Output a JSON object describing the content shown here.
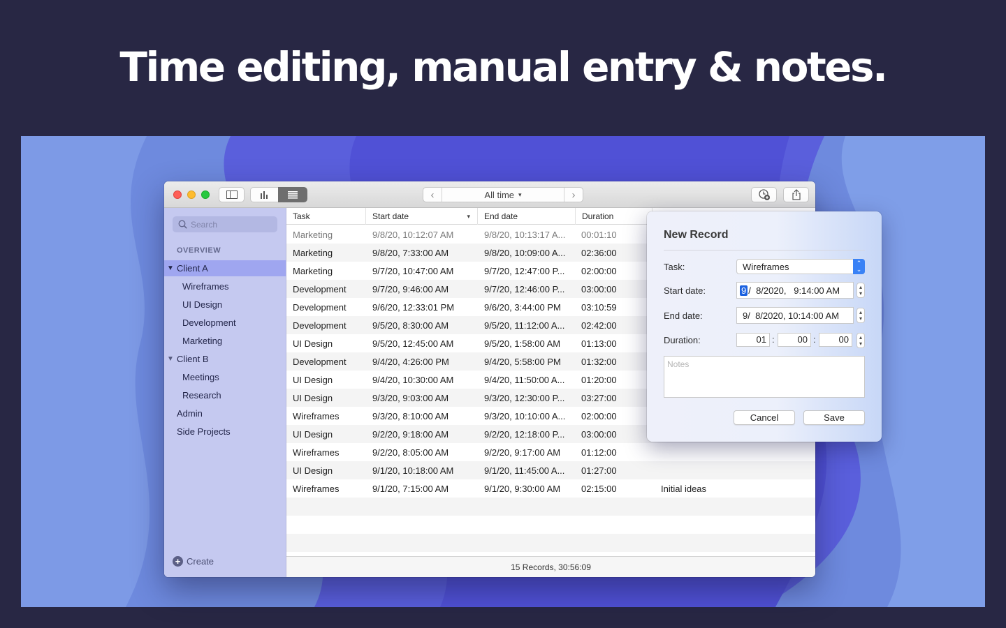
{
  "headline": "Time editing, manual entry & notes.",
  "toolbar": {
    "range_label": "All time",
    "prev_icon": "chevron-left-icon",
    "next_icon": "chevron-right-icon"
  },
  "sidebar": {
    "search_placeholder": "Search",
    "section": "OVERVIEW",
    "clients": [
      {
        "label": "Client A",
        "selected": true,
        "tasks": [
          "Wireframes",
          "UI Design",
          "Development",
          "Marketing"
        ]
      },
      {
        "label": "Client B",
        "selected": false,
        "tasks": [
          "Meetings",
          "Research"
        ]
      }
    ],
    "others": [
      "Admin",
      "Side Projects"
    ],
    "create_label": "Create"
  },
  "table": {
    "columns": [
      "Task",
      "Start date",
      "End date",
      "Duration"
    ],
    "rows": [
      {
        "task": "Marketing",
        "start": "9/8/20, 10:12:07 AM",
        "end": "9/8/20, 10:13:17 A...",
        "duration": "00:01:10",
        "note": "",
        "dim": true
      },
      {
        "task": "Marketing",
        "start": "9/8/20, 7:33:00 AM",
        "end": "9/8/20, 10:09:00 A...",
        "duration": "02:36:00",
        "note": ""
      },
      {
        "task": "Marketing",
        "start": "9/7/20, 10:47:00 AM",
        "end": "9/7/20, 12:47:00 P...",
        "duration": "02:00:00",
        "note": ""
      },
      {
        "task": "Development",
        "start": "9/7/20, 9:46:00 AM",
        "end": "9/7/20, 12:46:00 P...",
        "duration": "03:00:00",
        "note": ""
      },
      {
        "task": "Development",
        "start": "9/6/20, 12:33:01 PM",
        "end": "9/6/20, 3:44:00 PM",
        "duration": "03:10:59",
        "note": ""
      },
      {
        "task": "Development",
        "start": "9/5/20, 8:30:00 AM",
        "end": "9/5/20, 11:12:00 A...",
        "duration": "02:42:00",
        "note": ""
      },
      {
        "task": "UI Design",
        "start": "9/5/20, 12:45:00 AM",
        "end": "9/5/20, 1:58:00 AM",
        "duration": "01:13:00",
        "note": ""
      },
      {
        "task": "Development",
        "start": "9/4/20, 4:26:00 PM",
        "end": "9/4/20, 5:58:00 PM",
        "duration": "01:32:00",
        "note": ""
      },
      {
        "task": "UI Design",
        "start": "9/4/20, 10:30:00 AM",
        "end": "9/4/20, 11:50:00 A...",
        "duration": "01:20:00",
        "note": ""
      },
      {
        "task": "UI Design",
        "start": "9/3/20, 9:03:00 AM",
        "end": "9/3/20, 12:30:00 P...",
        "duration": "03:27:00",
        "note": ""
      },
      {
        "task": "Wireframes",
        "start": "9/3/20, 8:10:00 AM",
        "end": "9/3/20, 10:10:00 A...",
        "duration": "02:00:00",
        "note": ""
      },
      {
        "task": "UI Design",
        "start": "9/2/20, 9:18:00 AM",
        "end": "9/2/20, 12:18:00 P...",
        "duration": "03:00:00",
        "note": ""
      },
      {
        "task": "Wireframes",
        "start": "9/2/20, 8:05:00 AM",
        "end": "9/2/20, 9:17:00 AM",
        "duration": "01:12:00",
        "note": ""
      },
      {
        "task": "UI Design",
        "start": "9/1/20, 10:18:00 AM",
        "end": "9/1/20, 11:45:00 A...",
        "duration": "01:27:00",
        "note": ""
      },
      {
        "task": "Wireframes",
        "start": "9/1/20, 7:15:00 AM",
        "end": "9/1/20, 9:30:00 AM",
        "duration": "02:15:00",
        "note": "Initial ideas"
      }
    ],
    "status": "15 Records, 30:56:09"
  },
  "popover": {
    "title": "New Record",
    "task_label": "Task:",
    "task_value": "Wireframes",
    "start_label": "Start date:",
    "start_month": "9",
    "start_rest": "/  8/2020,   9:14:00 AM",
    "end_label": "End date:",
    "end_value": "9/  8/2020, 10:14:00 AM",
    "duration_label": "Duration:",
    "dur_h": "01",
    "dur_m": "00",
    "dur_s": "00",
    "notes_placeholder": "Notes",
    "cancel": "Cancel",
    "save": "Save"
  },
  "colors": {
    "sidebar_bg": "#c5c9f0",
    "sidebar_selected": "#9fa6f0",
    "accent": "#3a82f6",
    "page_bg": "#282744"
  }
}
